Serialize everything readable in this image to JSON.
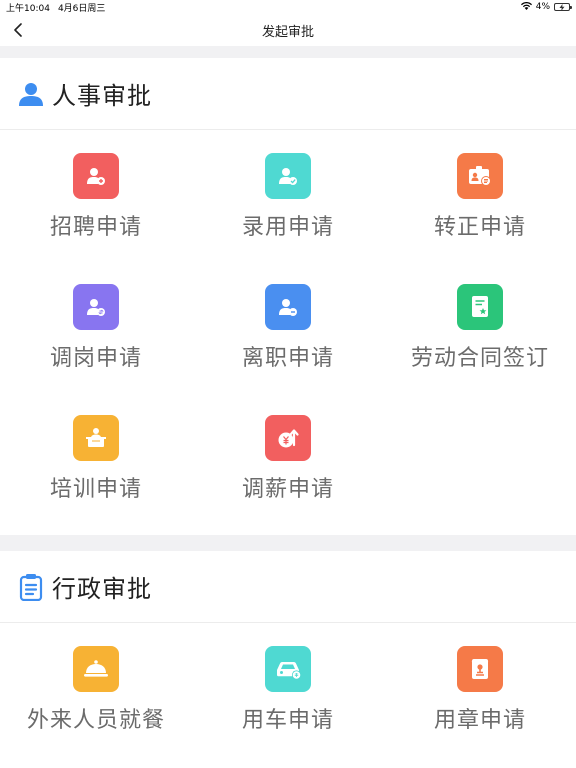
{
  "status_bar": {
    "time": "上午10:04",
    "date": "4月6日周三",
    "battery": "4%"
  },
  "nav": {
    "title": "发起审批"
  },
  "sections": [
    {
      "title": "人事审批",
      "icon": "person-icon",
      "items": [
        {
          "label": "招聘申请",
          "icon": "recruit-icon",
          "color": "#f25f5f"
        },
        {
          "label": "录用申请",
          "icon": "hire-icon",
          "color": "#4fd9d2"
        },
        {
          "label": "转正申请",
          "icon": "regularization-icon",
          "color": "#f57a48"
        },
        {
          "label": "调岗申请",
          "icon": "transfer-icon",
          "color": "#8875f0"
        },
        {
          "label": "离职申请",
          "icon": "resign-icon",
          "color": "#4a8ff0"
        },
        {
          "label": "劳动合同签订",
          "icon": "contract-icon",
          "color": "#2bc57a"
        },
        {
          "label": "培训申请",
          "icon": "training-icon",
          "color": "#f7b234"
        },
        {
          "label": "调薪申请",
          "icon": "salary-icon",
          "color": "#f25f5f"
        }
      ]
    },
    {
      "title": "行政审批",
      "icon": "clipboard-icon",
      "items": [
        {
          "label": "外来人员就餐",
          "icon": "dining-icon",
          "color": "#f7b234"
        },
        {
          "label": "用车申请",
          "icon": "car-icon",
          "color": "#4fd9d2"
        },
        {
          "label": "用章申请",
          "icon": "seal-icon",
          "color": "#f57a48"
        }
      ]
    }
  ]
}
